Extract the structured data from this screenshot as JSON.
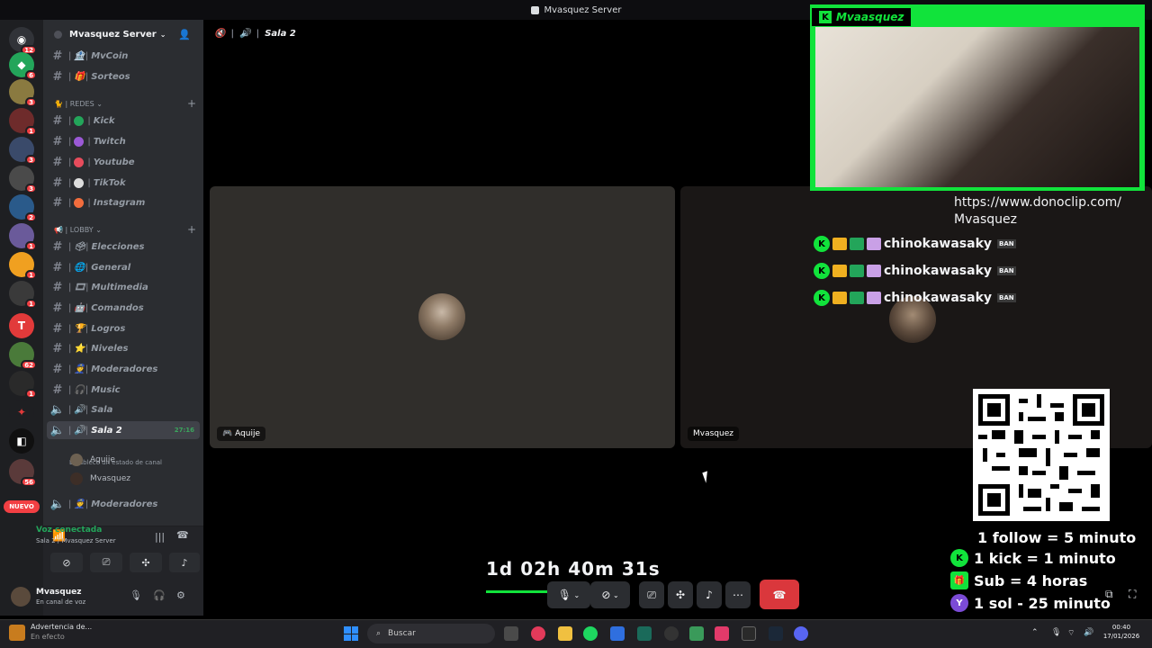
{
  "window_title": "Mvasquez Server",
  "rail": {
    "badges": [
      "12",
      "6",
      "3",
      "1",
      "3",
      "3",
      "2",
      "1",
      "1",
      "1",
      "62",
      "1",
      "56"
    ],
    "new_label": "NUEVO"
  },
  "server": {
    "name": "Mvasquez Server"
  },
  "channels_top": [
    {
      "emoji": "🏦",
      "label": "MvCoin"
    },
    {
      "emoji": "🎁",
      "label": "Sorteos"
    }
  ],
  "category_redes": "REDES",
  "channels_redes": [
    {
      "color": "#23a55a",
      "label": "Kick"
    },
    {
      "color": "#9b59d6",
      "label": "Twitch"
    },
    {
      "color": "#e74c5c",
      "label": "Youtube"
    },
    {
      "color": "#dddddd",
      "label": "TikTok"
    },
    {
      "color": "#f26d3d",
      "label": "Instagram"
    }
  ],
  "category_lobby": "LOBBY",
  "channels_lobby": [
    {
      "emoji": "🗳",
      "label": "Elecciones"
    },
    {
      "emoji": "🌐",
      "label": "General"
    },
    {
      "emoji": "🎞",
      "label": "Multimedia"
    },
    {
      "emoji": "🤖",
      "label": "Comandos"
    },
    {
      "emoji": "🏆",
      "label": "Logros"
    },
    {
      "emoji": "⭐",
      "label": "Niveles"
    },
    {
      "emoji": "👮",
      "label": "Moderadores"
    },
    {
      "emoji": "🎧",
      "label": "Music"
    }
  ],
  "voice": {
    "sala": "Sala",
    "sala2": "Sala 2",
    "sala2_time": "27:16",
    "sala2_status": "Establece un estado de canal",
    "members": [
      "Aquije",
      "Mvasquez"
    ],
    "moderadores": "Moderadores"
  },
  "voice_panel": {
    "title": "Voz conectada",
    "subtitle": "Sala 2 / Mvasquez Server"
  },
  "user_panel": {
    "name": "Mvasquez",
    "status": "En canal de voz"
  },
  "stage": {
    "channel_title": "Sala 2",
    "tile_left_name": "Aquije",
    "tile_right_name": "Mvasquez"
  },
  "overlay": {
    "cam_label": "Mvaasquez",
    "url": "https://www.donoclip.com/\nMvasquez",
    "chat_user": "chinokawasaky",
    "chat_ban": "BAN",
    "timer": "1d 02h 40m 31s",
    "info": [
      {
        "text": "1 follow = 5 minuto",
        "color": "#000000",
        "icon": ""
      },
      {
        "text": "1 kick = 1 minuto",
        "color": "#11e33b",
        "icon": "K"
      },
      {
        "text": "Sub = 4 horas",
        "color": "#11e33b",
        "icon": "🎁"
      },
      {
        "text": "1 sol - 25 minuto",
        "color": "#7b4bd6",
        "icon": "Y"
      }
    ]
  },
  "taskbar": {
    "alert_title": "Advertencia de...",
    "alert_sub": "En efecto",
    "search_placeholder": "Buscar",
    "time": "00:40",
    "date": "17/01/2026"
  },
  "colors": {
    "accent_green": "#11e33b",
    "discord_green": "#23a55a",
    "end_call_red": "#da373c"
  }
}
